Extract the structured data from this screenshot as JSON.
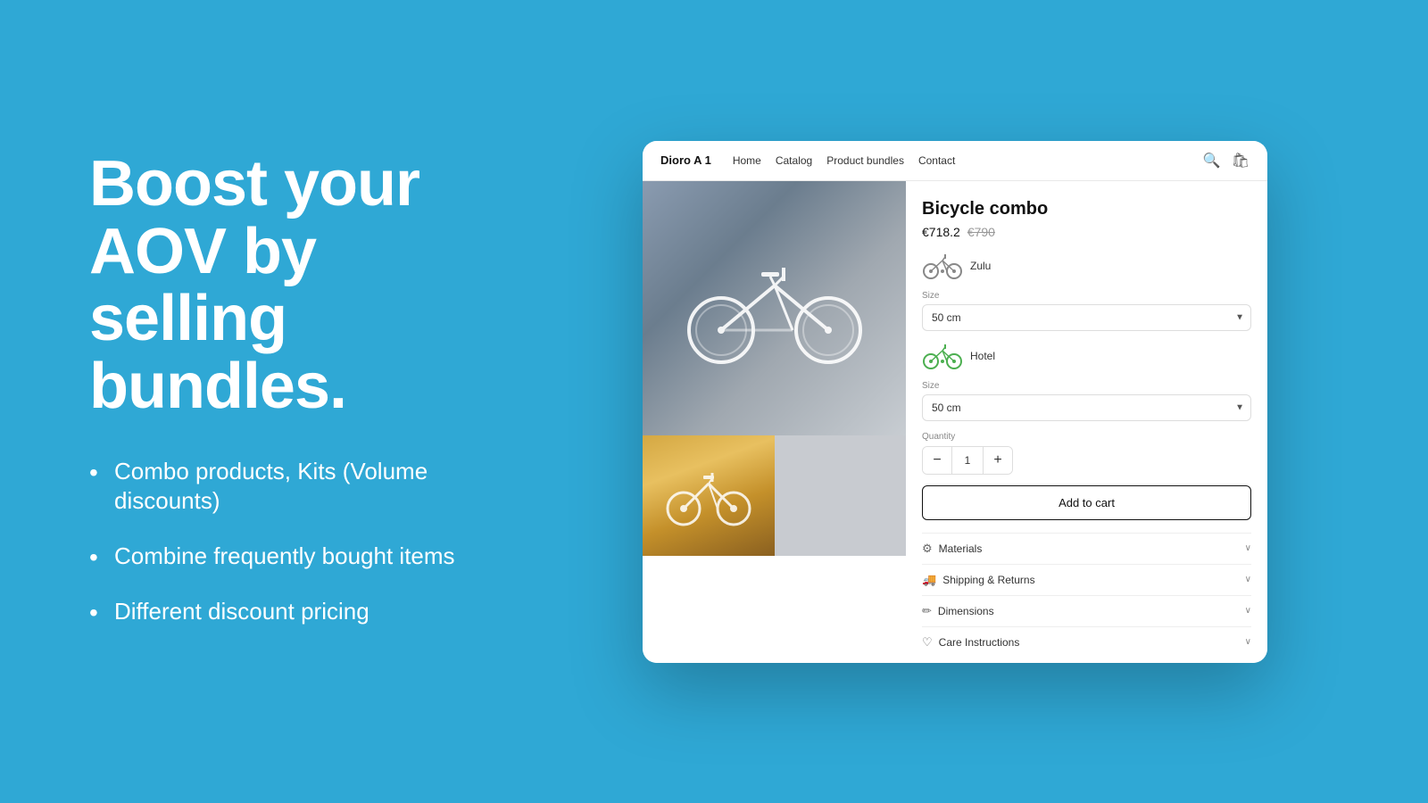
{
  "left": {
    "hero_title": "Boost your AOV by selling bundles.",
    "bullets": [
      "Combo products, Kits (Volume discounts)",
      "Combine frequently bought items",
      "Different discount pricing"
    ]
  },
  "store": {
    "brand": "Dioro A 1",
    "nav_links": [
      "Home",
      "Catalog",
      "Product bundles",
      "Contact"
    ],
    "product": {
      "title": "Bicycle combo",
      "price_current": "€718.2",
      "price_original": "€790",
      "bundle_items": [
        {
          "name": "Zulu",
          "size_label": "Size",
          "size_value": "50 cm"
        },
        {
          "name": "Hotel",
          "size_label": "Size",
          "size_value": "50 cm"
        }
      ],
      "quantity_label": "Quantity",
      "quantity_value": "1",
      "add_to_cart_label": "Add to cart",
      "accordion": [
        {
          "icon": "⚙",
          "label": "Materials"
        },
        {
          "icon": "🚚",
          "label": "Shipping & Returns"
        },
        {
          "icon": "✏",
          "label": "Dimensions"
        },
        {
          "icon": "♡",
          "label": "Care Instructions"
        }
      ]
    }
  }
}
